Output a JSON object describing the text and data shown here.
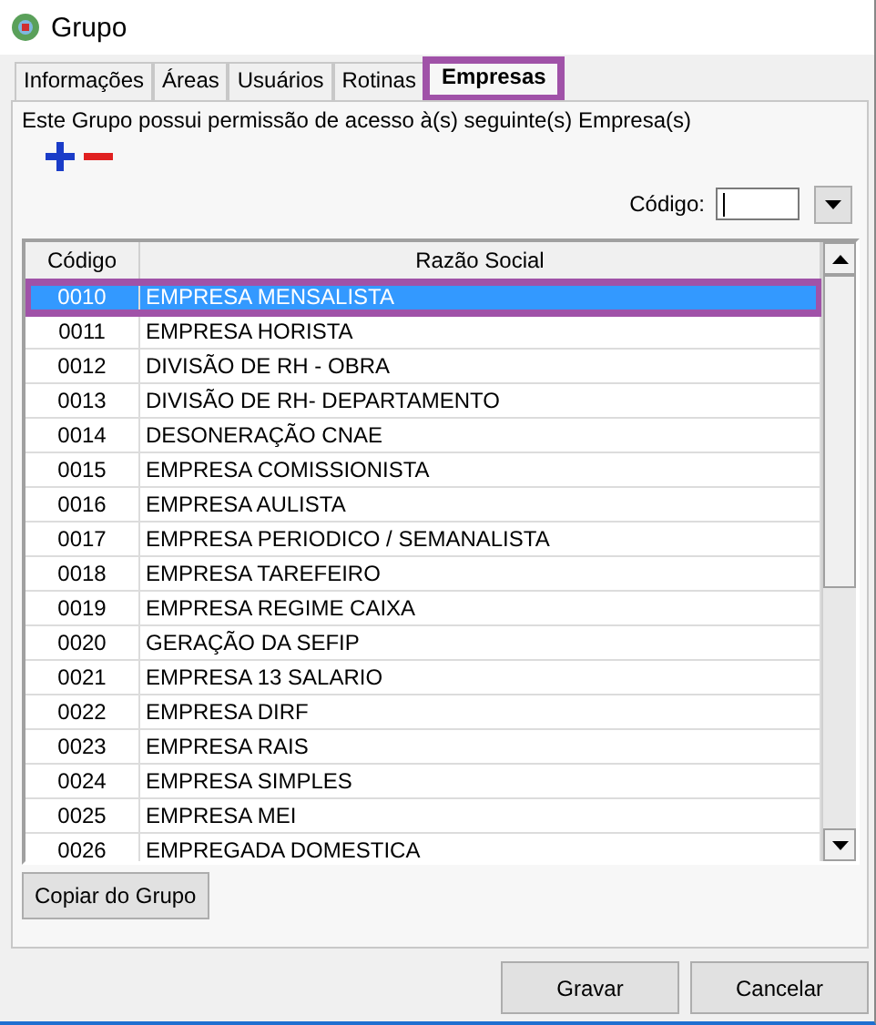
{
  "window": {
    "title": "Grupo"
  },
  "tabs": [
    {
      "label": "Informações",
      "selected": false,
      "highlighted": false
    },
    {
      "label": "Áreas",
      "selected": false,
      "highlighted": false
    },
    {
      "label": "Usuários",
      "selected": false,
      "highlighted": false
    },
    {
      "label": "Rotinas",
      "selected": false,
      "highlighted": false
    },
    {
      "label": "Empresas",
      "selected": true,
      "highlighted": true
    }
  ],
  "description": "Este Grupo possui permissão de acesso à(s) seguinte(s) Empresa(s)",
  "search": {
    "label": "Código:"
  },
  "table": {
    "columns": [
      "Código",
      "Razão Social"
    ],
    "rows": [
      {
        "code": "0010",
        "name": "EMPRESA MENSALISTA",
        "selected": true,
        "highlighted": true
      },
      {
        "code": "0011",
        "name": "EMPRESA HORISTA",
        "selected": false,
        "highlighted": false
      },
      {
        "code": "0012",
        "name": "DIVISÃO DE RH - OBRA",
        "selected": false,
        "highlighted": false
      },
      {
        "code": "0013",
        "name": "DIVISÃO DE RH- DEPARTAMENTO",
        "selected": false,
        "highlighted": false
      },
      {
        "code": "0014",
        "name": "DESONERAÇÃO CNAE",
        "selected": false,
        "highlighted": false
      },
      {
        "code": "0015",
        "name": "EMPRESA COMISSIONISTA",
        "selected": false,
        "highlighted": false
      },
      {
        "code": "0016",
        "name": "EMPRESA AULISTA",
        "selected": false,
        "highlighted": false
      },
      {
        "code": "0017",
        "name": "EMPRESA PERIODICO / SEMANALISTA",
        "selected": false,
        "highlighted": false
      },
      {
        "code": "0018",
        "name": "EMPRESA TAREFEIRO",
        "selected": false,
        "highlighted": false
      },
      {
        "code": "0019",
        "name": "EMPRESA REGIME CAIXA",
        "selected": false,
        "highlighted": false
      },
      {
        "code": "0020",
        "name": "GERAÇÃO DA SEFIP",
        "selected": false,
        "highlighted": false
      },
      {
        "code": "0021",
        "name": "EMPRESA 13 SALARIO",
        "selected": false,
        "highlighted": false
      },
      {
        "code": "0022",
        "name": "EMPRESA DIRF",
        "selected": false,
        "highlighted": false
      },
      {
        "code": "0023",
        "name": "EMPRESA RAIS",
        "selected": false,
        "highlighted": false
      },
      {
        "code": "0024",
        "name": "EMPRESA SIMPLES",
        "selected": false,
        "highlighted": false
      },
      {
        "code": "0025",
        "name": "EMPRESA MEI",
        "selected": false,
        "highlighted": false
      },
      {
        "code": "0026",
        "name": "EMPREGADA DOMESTICA",
        "selected": false,
        "highlighted": false
      }
    ]
  },
  "copy_button": "Copiar do Grupo",
  "buttons": [
    "Gravar",
    "Cancelar"
  ]
}
